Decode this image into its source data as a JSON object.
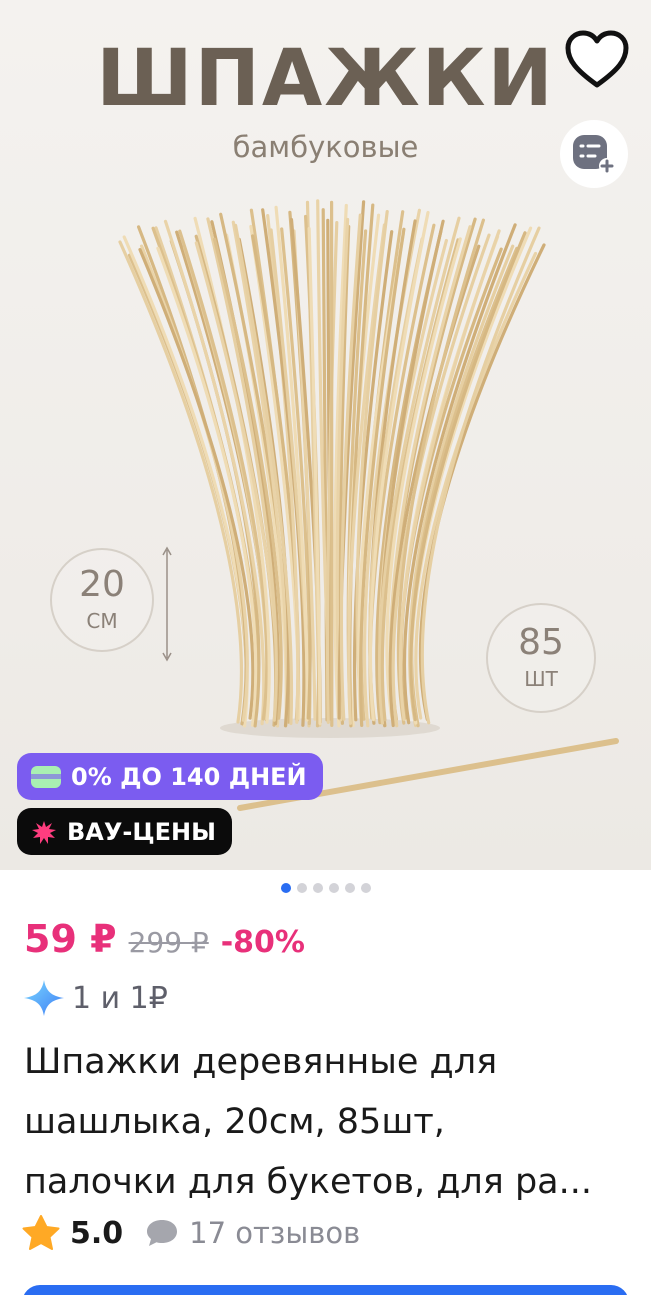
{
  "hero": {
    "title": "ШПАЖКИ",
    "subtitle": "бамбуковые",
    "length_value": "20",
    "length_unit": "СМ",
    "count_value": "85",
    "count_unit": "ШТ"
  },
  "badges": {
    "installment": "0% ДО 140 ДНЕЙ",
    "wow_prices": "ВАУ-ЦЕНЫ"
  },
  "gallery": {
    "total_images": 6,
    "active_index": 0
  },
  "price": {
    "current": "59 ₽",
    "old": "299 ₽",
    "discount": "-80%"
  },
  "promo": {
    "text": "1 и 1₽"
  },
  "product": {
    "title_lines": [
      "Шпажки деревянные для",
      "шашлыка, 20см, 85шт,",
      "палочки для букетов, для ра..."
    ]
  },
  "rating": {
    "value": "5.0",
    "reviews": "17 отзывов"
  },
  "colors": {
    "accent": "#e8307a",
    "promo_purple": "#7b5cf0",
    "primary_blue": "#2a6df2"
  },
  "icons": {
    "favorite": "heart-icon",
    "share": "share-list-icon",
    "card": "card-icon",
    "wow": "splash-icon",
    "promo": "sparkle-icon",
    "star": "star-icon",
    "reviews": "comment-icon"
  }
}
